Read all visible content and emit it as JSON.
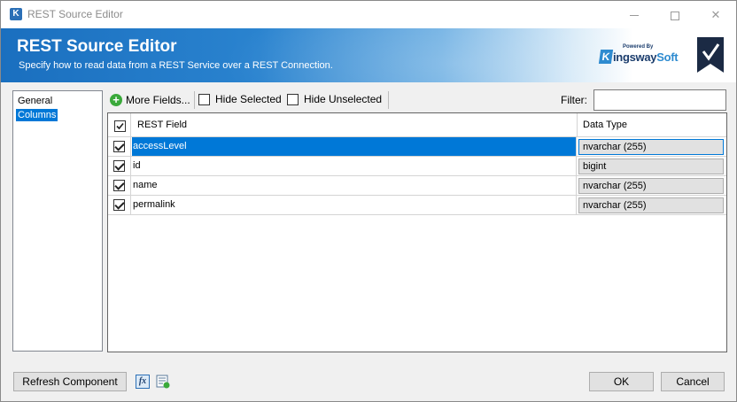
{
  "window": {
    "title": "REST Source Editor",
    "controls": {
      "minimize": "minimize-icon",
      "maximize": "maximize-icon",
      "close": "✕"
    }
  },
  "banner": {
    "title": "REST Source Editor",
    "subtitle": "Specify how to read data from a REST Service over a REST Connection.",
    "logo_powered": "Powered By",
    "logo_k": "K",
    "logo_word": "ingsway",
    "logo_soft": "Soft"
  },
  "nav": {
    "items": [
      {
        "label": "General",
        "selected": false
      },
      {
        "label": "Columns",
        "selected": true
      }
    ]
  },
  "toolbar": {
    "more_fields": "More Fields...",
    "hide_selected": "Hide Selected",
    "hide_unselected": "Hide Unselected",
    "filter_label": "Filter:",
    "filter_value": ""
  },
  "grid": {
    "columns": [
      "REST Field",
      "Data Type"
    ],
    "rows": [
      {
        "checked": true,
        "field": "accessLevel",
        "type": "nvarchar (255)",
        "selected": true
      },
      {
        "checked": true,
        "field": "id",
        "type": "bigint",
        "selected": false
      },
      {
        "checked": true,
        "field": "name",
        "type": "nvarchar (255)",
        "selected": false
      },
      {
        "checked": true,
        "field": "permalink",
        "type": "nvarchar (255)",
        "selected": false
      }
    ]
  },
  "footer": {
    "refresh": "Refresh Component",
    "ok": "OK",
    "cancel": "Cancel",
    "fx_icon": "fx"
  },
  "colors": {
    "accent": "#0078d7",
    "banner": "#1a6fbf"
  }
}
